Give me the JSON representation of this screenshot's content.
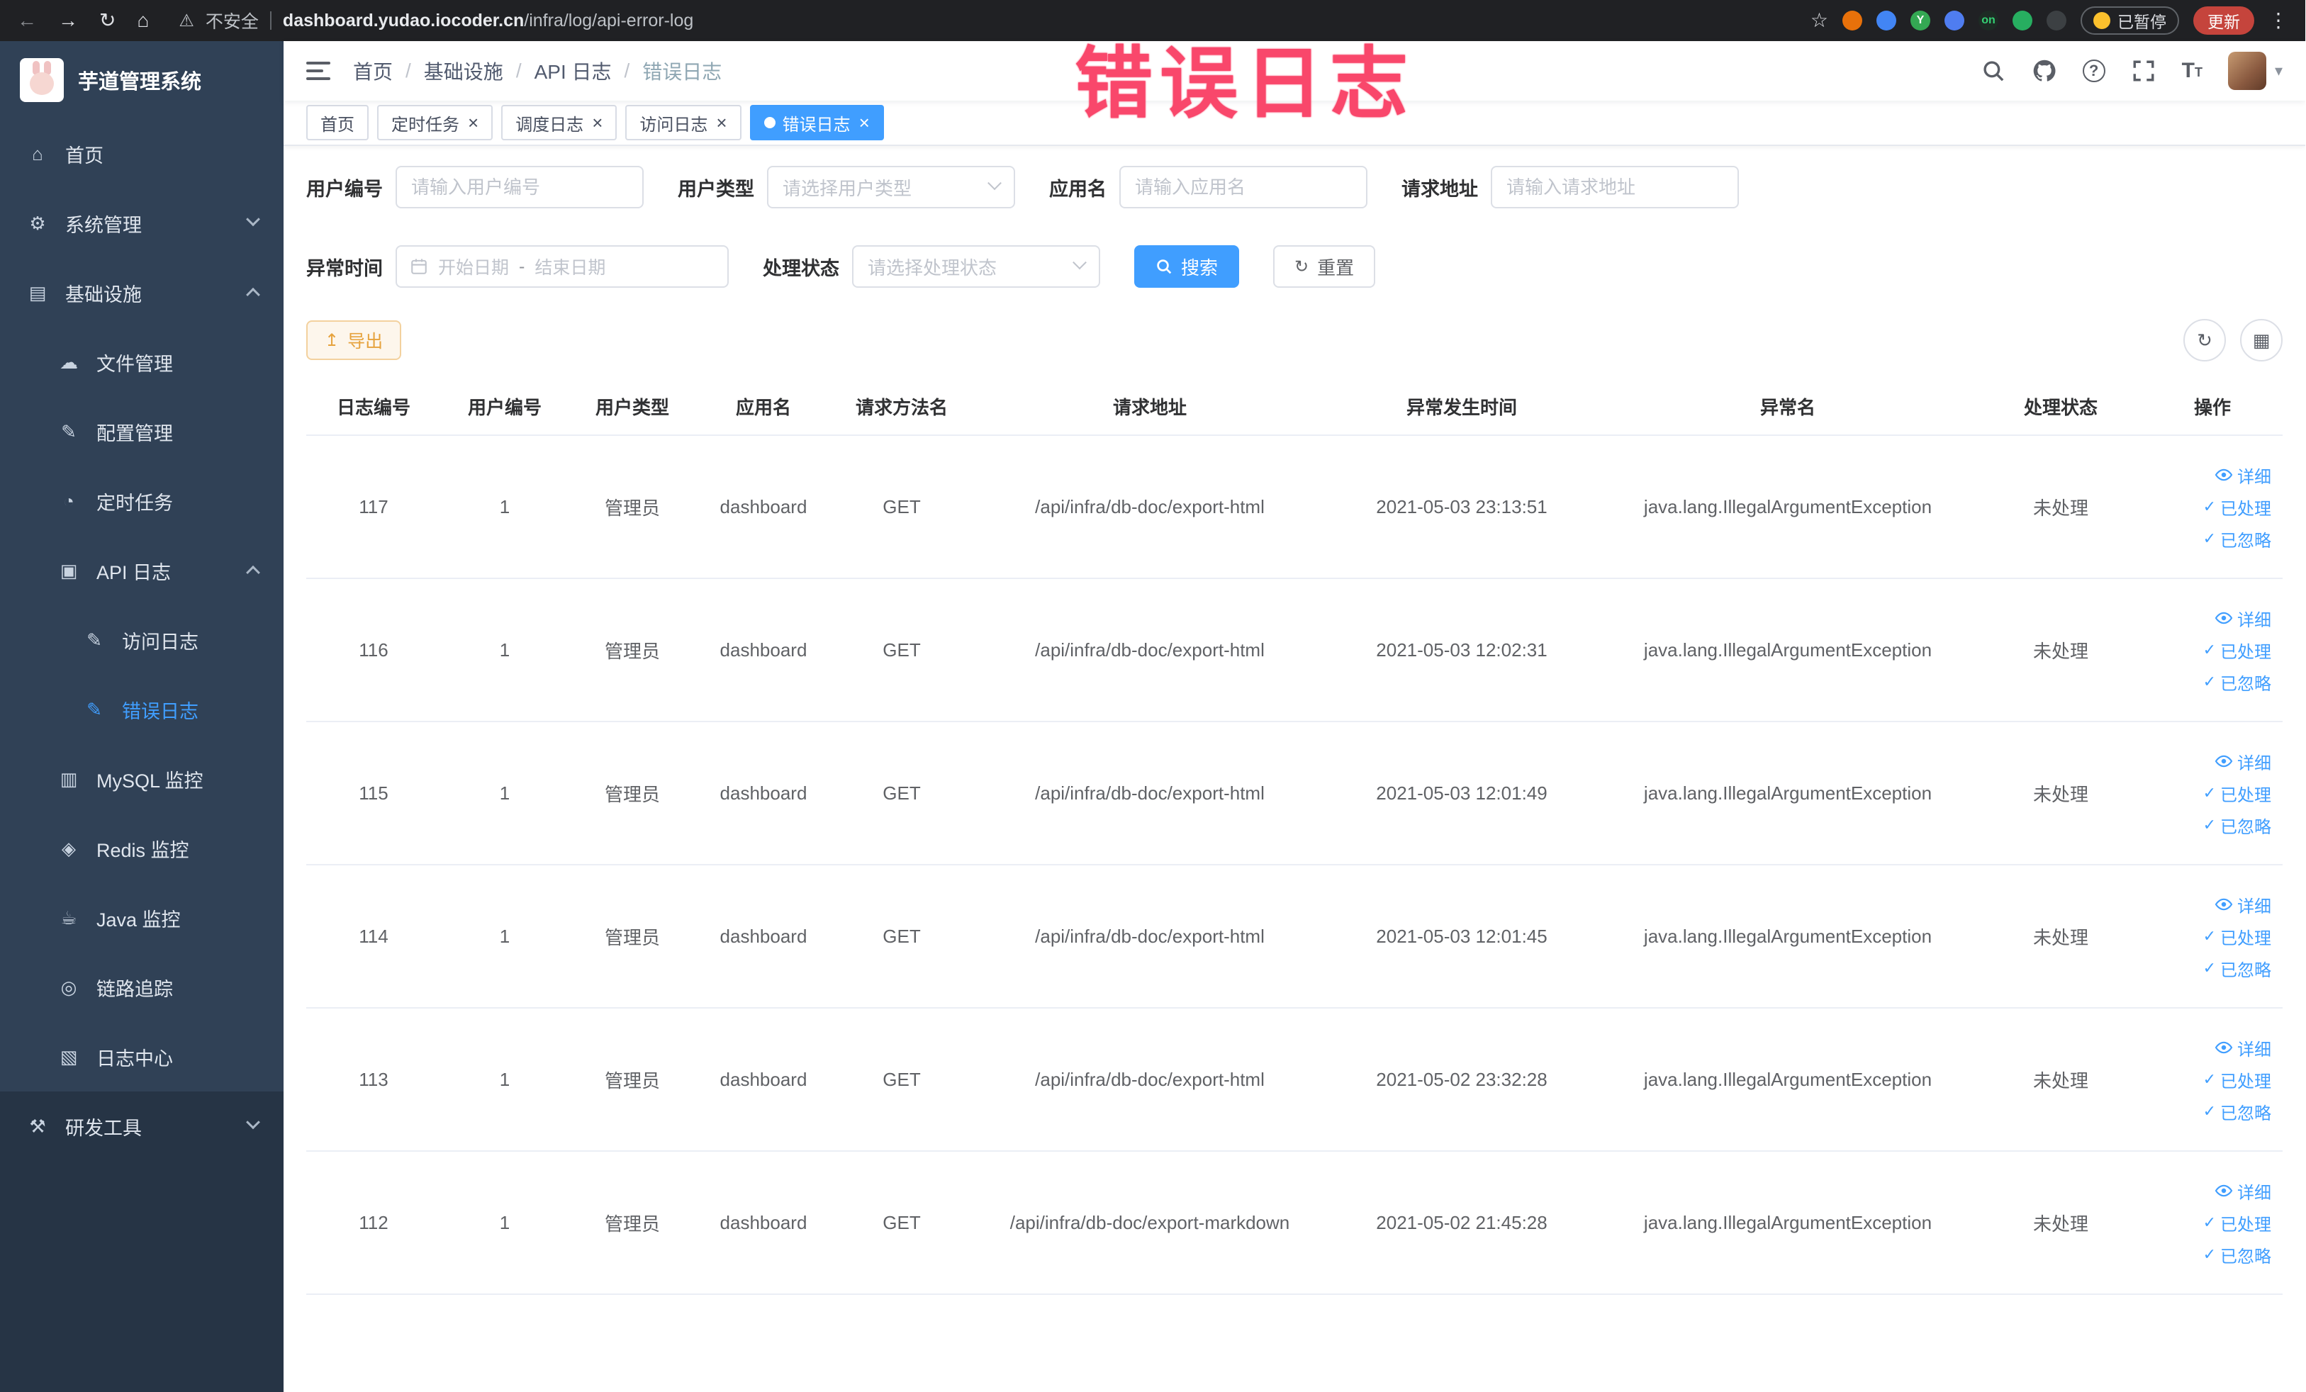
{
  "browser": {
    "security_label": "不安全",
    "url_domain": "dashboard.yudao.iocoder.cn",
    "url_path": "/infra/log/api-error-log",
    "paused_badge": "已暂停",
    "update_button": "更新",
    "extension_on_label": "on",
    "extension_y_label": "Y"
  },
  "watermark": "错误日志",
  "sidebar": {
    "title": "芋道管理系统",
    "items": [
      {
        "label": "首页",
        "level": 1,
        "icon": "home"
      },
      {
        "label": "系统管理",
        "level": 1,
        "icon": "gear",
        "chevron": "down"
      },
      {
        "label": "基础设施",
        "level": 1,
        "icon": "infra",
        "chevron": "up"
      },
      {
        "label": "文件管理",
        "level": 2,
        "icon": "cloud"
      },
      {
        "label": "配置管理",
        "level": 2,
        "icon": "edit"
      },
      {
        "label": "定时任务",
        "level": 2,
        "icon": "clock"
      },
      {
        "label": "API 日志",
        "level": 2,
        "icon": "api",
        "chevron": "up"
      },
      {
        "label": "访问日志",
        "level": 3,
        "icon": "editdoc"
      },
      {
        "label": "错误日志",
        "level": 3,
        "icon": "editdoc",
        "active": true
      },
      {
        "label": "MySQL 监控",
        "level": 2,
        "icon": "mysql"
      },
      {
        "label": "Redis 监控",
        "level": 2,
        "icon": "redis"
      },
      {
        "label": "Java 监控",
        "level": 2,
        "icon": "java"
      },
      {
        "label": "链路追踪",
        "level": 2,
        "icon": "trace"
      },
      {
        "label": "日志中心",
        "level": 2,
        "icon": "logcenter"
      },
      {
        "label": "研发工具",
        "level": 1,
        "icon": "tools",
        "chevron": "down",
        "dark": true
      }
    ]
  },
  "breadcrumb": {
    "items": [
      "首页",
      "基础设施",
      "API 日志",
      "错误日志"
    ],
    "separator": "/"
  },
  "tabs": [
    {
      "label": "首页",
      "closable": false,
      "active": false
    },
    {
      "label": "定时任务",
      "closable": true,
      "active": false
    },
    {
      "label": "调度日志",
      "closable": true,
      "active": false
    },
    {
      "label": "访问日志",
      "closable": true,
      "active": false
    },
    {
      "label": "错误日志",
      "closable": true,
      "active": true
    }
  ],
  "filters": {
    "user_id": {
      "label": "用户编号",
      "placeholder": "请输入用户编号"
    },
    "user_type": {
      "label": "用户类型",
      "placeholder": "请选择用户类型"
    },
    "app_name": {
      "label": "应用名",
      "placeholder": "请输入应用名"
    },
    "request_url": {
      "label": "请求地址",
      "placeholder": "请输入请求地址"
    },
    "exception_time": {
      "label": "异常时间",
      "start_placeholder": "开始日期",
      "separator": "-",
      "end_placeholder": "结束日期"
    },
    "process_status": {
      "label": "处理状态",
      "placeholder": "请选择处理状态"
    },
    "search_button": "搜索",
    "reset_button": "重置"
  },
  "toolbar": {
    "export_button": "导出"
  },
  "table": {
    "headers": [
      "日志编号",
      "用户编号",
      "用户类型",
      "应用名",
      "请求方法名",
      "请求地址",
      "异常发生时间",
      "异常名",
      "处理状态",
      "操作"
    ],
    "actions": {
      "detail": "详细",
      "processed": "已处理",
      "ignored": "已忽略"
    },
    "rows": [
      {
        "id": "117",
        "user_id": "1",
        "user_type": "管理员",
        "app": "dashboard",
        "method": "GET",
        "url": "/api/infra/db-doc/export-html",
        "time": "2021-05-03 23:13:51",
        "exception": "java.lang.IllegalArgumentException",
        "status": "未处理"
      },
      {
        "id": "116",
        "user_id": "1",
        "user_type": "管理员",
        "app": "dashboard",
        "method": "GET",
        "url": "/api/infra/db-doc/export-html",
        "time": "2021-05-03 12:02:31",
        "exception": "java.lang.IllegalArgumentException",
        "status": "未处理"
      },
      {
        "id": "115",
        "user_id": "1",
        "user_type": "管理员",
        "app": "dashboard",
        "method": "GET",
        "url": "/api/infra/db-doc/export-html",
        "time": "2021-05-03 12:01:49",
        "exception": "java.lang.IllegalArgumentException",
        "status": "未处理"
      },
      {
        "id": "114",
        "user_id": "1",
        "user_type": "管理员",
        "app": "dashboard",
        "method": "GET",
        "url": "/api/infra/db-doc/export-html",
        "time": "2021-05-03 12:01:45",
        "exception": "java.lang.IllegalArgumentException",
        "status": "未处理"
      },
      {
        "id": "113",
        "user_id": "1",
        "user_type": "管理员",
        "app": "dashboard",
        "method": "GET",
        "url": "/api/infra/db-doc/export-html",
        "time": "2021-05-02 23:32:28",
        "exception": "java.lang.IllegalArgumentException",
        "status": "未处理"
      },
      {
        "id": "112",
        "user_id": "1",
        "user_type": "管理员",
        "app": "dashboard",
        "method": "GET",
        "url": "/api/infra/db-doc/export-markdown",
        "time": "2021-05-02 21:45:28",
        "exception": "java.lang.IllegalArgumentException",
        "status": "未处理"
      }
    ]
  }
}
